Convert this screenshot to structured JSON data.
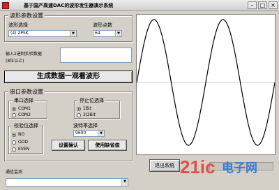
{
  "window": {
    "title": "基于国产高速DAC的波形发生器演示系统"
  },
  "wave_params": {
    "group_label": "波形参数设置",
    "wave_select_label": "波形选择",
    "wave_select_value": "(4) 2PSK",
    "points_label": "波形点数",
    "points_value": "64"
  },
  "input": {
    "label_line1": "输入2进制实验数据",
    "label_line2": "(8位以上)",
    "value": ""
  },
  "generate_button": "生成数据一观看波形",
  "serial": {
    "group_label": "串口参数设置",
    "port": {
      "label": "串口选择",
      "options": [
        "COM1",
        "COM2"
      ],
      "selected": 0
    },
    "stopbit": {
      "label": "停止位选择",
      "options": [
        "1Bit",
        "3/2Bit"
      ],
      "selected": 0
    },
    "parity": {
      "label": "校验位选择",
      "options": [
        "NO",
        "ODD",
        "EVEN"
      ],
      "selected": 0
    },
    "baud": {
      "label": "波特率选择",
      "value": "9600"
    },
    "confirm_button": "设置确认",
    "default_button": "使用缺省值"
  },
  "status": {
    "label": "通信监测",
    "value": ""
  },
  "close_button": "退出系统",
  "colors": {
    "window_bg": "#d4d0c8",
    "waveform": "#000000",
    "plot_bg": "#ffffff"
  },
  "watermark": {
    "text1": "21ic",
    "text2": "电子网"
  }
}
